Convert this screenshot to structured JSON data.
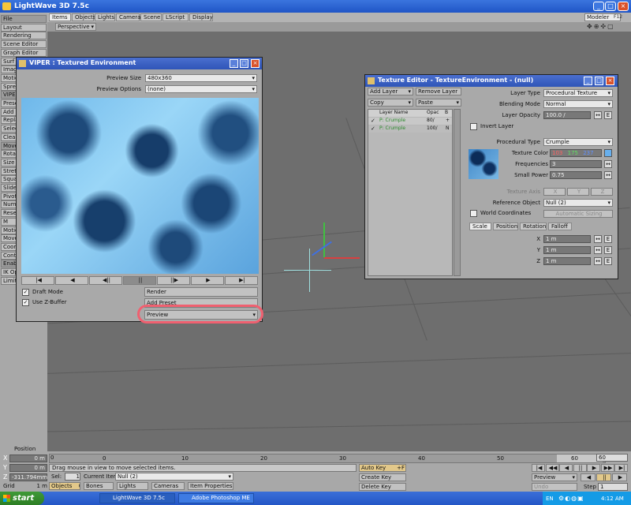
{
  "app": {
    "title": "LightWave 3D 7.5c",
    "modeler": "Modeler",
    "f12": "F12"
  },
  "tabs": [
    "Items",
    "Objects",
    "Lights",
    "Camera",
    "Scene",
    "LScript",
    "Display"
  ],
  "view": {
    "mode": "Perspective"
  },
  "left_menu": [
    {
      "label": "File",
      "dark": true
    },
    {
      "label": "Layout",
      "dark": false
    },
    {
      "label": "Rendering",
      "dark": false
    },
    {
      "label": "Scene Editor",
      "dark": false
    },
    {
      "label": "Graph Editor",
      "dark": false
    },
    {
      "label": "Surf",
      "dark": false
    },
    {
      "label": "Imag",
      "dark": false
    },
    {
      "label": "Motio",
      "dark": false
    },
    {
      "label": "Spre",
      "dark": false
    },
    {
      "label": "VIPE",
      "dark": true
    },
    {
      "label": "Prese",
      "dark": false
    },
    {
      "label": "Add",
      "dark": false
    },
    {
      "label": "Repla",
      "dark": false
    },
    {
      "label": "Selec",
      "dark": false
    },
    {
      "label": "Clear",
      "dark": false
    },
    {
      "label": "Move",
      "dark": true
    },
    {
      "label": "Rota",
      "dark": false
    },
    {
      "label": "Size",
      "dark": false
    },
    {
      "label": "Stret",
      "dark": false
    },
    {
      "label": "Squa",
      "dark": false
    },
    {
      "label": "Slide",
      "dark": false
    },
    {
      "label": "Pivot",
      "dark": false
    },
    {
      "label": "Num",
      "dark": false
    },
    {
      "label": "Reset",
      "dark": false
    },
    {
      "label": "M",
      "dark": false
    },
    {
      "label": "Motio",
      "dark": false
    },
    {
      "label": "Move",
      "dark": false
    },
    {
      "label": "Coor",
      "dark": false
    },
    {
      "label": "Contr",
      "dark": false
    },
    {
      "label": "Enab",
      "dark": true
    },
    {
      "label": "IK Op",
      "dark": false
    },
    {
      "label": "Limit",
      "dark": false
    }
  ],
  "viper": {
    "title": "VIPER : Textured Environment",
    "preview_size_label": "Preview Size",
    "preview_size_value": "480x360",
    "preview_options_label": "Preview Options",
    "preview_options_value": "(none)",
    "draft_mode": "Draft Mode",
    "use_zbuffer": "Use Z-Buffer",
    "render": "Render",
    "add_preset": "Add Preset",
    "preview": "Preview",
    "transport": [
      "|◀",
      "◀",
      "◀||",
      "||",
      "||▶",
      "▶",
      "▶|"
    ]
  },
  "texture_editor": {
    "title": "Texture Editor - TextureEnvironment - (null)",
    "add_layer": "Add Layer",
    "remove_layer": "Remove Layer",
    "copy": "Copy",
    "paste": "Paste",
    "columns": [
      "Layer Name",
      "Opac",
      "B"
    ],
    "layers": [
      {
        "name": "P: Crumple",
        "opac": "80/",
        "b": "+"
      },
      {
        "name": "P: Crumple",
        "opac": "100/",
        "b": "N"
      }
    ],
    "layer_type_label": "Layer Type",
    "layer_type": "Procedural Texture",
    "blending_mode_label": "Blending Mode",
    "blending_mode": "Normal",
    "layer_opacity_label": "Layer Opacity",
    "layer_opacity": "100.0 /",
    "invert_layer": "Invert Layer",
    "procedural_type_label": "Procedural Type",
    "procedural_type": "Crumple",
    "texture_color_label": "Texture Color",
    "texture_color": {
      "r": "103",
      "g": "175",
      "b": "237"
    },
    "frequencies_label": "Frequencies",
    "frequencies": "3",
    "small_power_label": "Small Power",
    "small_power": "0.75",
    "texture_axis_label": "Texture Axis",
    "axes": [
      "X",
      "Y",
      "Z"
    ],
    "reference_object_label": "Reference Object",
    "reference_object": "Null (2)",
    "world_coordinates": "World Coordinates",
    "automatic_sizing": "Automatic Sizing",
    "subtabs": [
      "Scale",
      "Position",
      "Rotation",
      "Falloff"
    ],
    "scale": [
      {
        "axis": "X",
        "value": "1 m"
      },
      {
        "axis": "Y",
        "value": "1 m"
      },
      {
        "axis": "Z",
        "value": "1 m"
      }
    ],
    "e": "E"
  },
  "bottom": {
    "position": "Position",
    "x_label": "X",
    "x_value": "0 m",
    "y_label": "Y",
    "y_value": "0 m",
    "z_label": "Z",
    "z_value": "-311.794mm",
    "grid_label": "Grid",
    "grid_value": "1 m",
    "status": "Drag mouse in view to move selected items.",
    "sel_label": "Sel:",
    "sel_value": "1",
    "current_item_label": "Current Item",
    "current_item": "Null (2)",
    "objects": "Objects",
    "objects_count": "0",
    "bones": "Bones",
    "lights": "Lights",
    "cameras": "Cameras",
    "item_properties": "Item Properties",
    "auto_key": "Auto Key",
    "auto_key_hotkey": "+F1",
    "create_key": "Create Key",
    "delete_key": "Delete Key",
    "preview": "Preview",
    "undo": "Undo",
    "step_label": "Step",
    "step_value": "1",
    "timeline_start": "0",
    "timeline_ticks": [
      "0",
      "10",
      "20",
      "30",
      "40",
      "50",
      "60"
    ],
    "timeline_end": "60",
    "timeline_current": "60"
  },
  "taskbar": {
    "start": "start",
    "tasks": [
      "LightWave 3D 7.5c",
      "Adobe Photoshop ME"
    ],
    "lang": "EN",
    "time": "4:12 AM"
  }
}
